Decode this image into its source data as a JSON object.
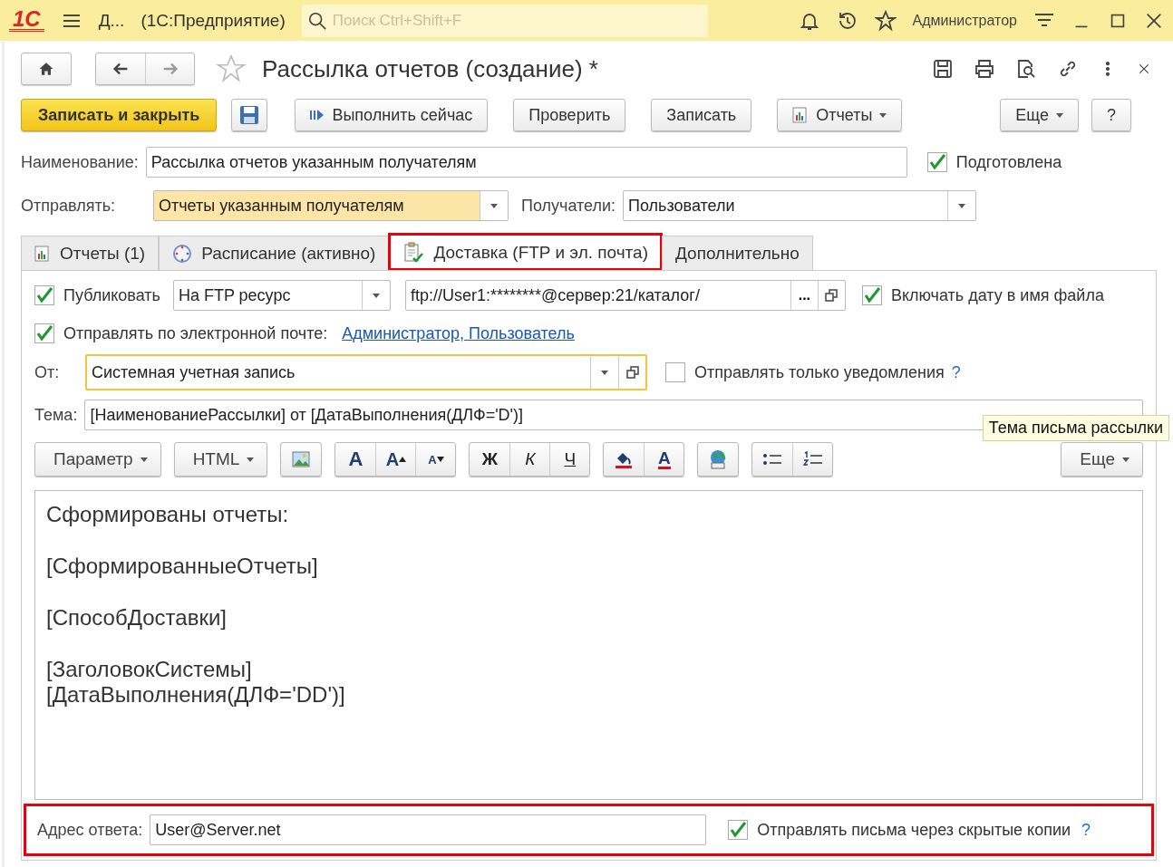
{
  "app_bar": {
    "logo": "1С",
    "section": "Д...",
    "app_name": "(1С:Предприятие)",
    "search": {
      "placeholder": "Поиск Ctrl+Shift+F"
    },
    "user": "Администратор"
  },
  "form": {
    "title": "Рассылка отчетов (создание) *",
    "favorite": false,
    "toolbar": [
      {
        "kind": "primary",
        "label": "Записать и закрыть"
      },
      {
        "kind": "save"
      },
      {
        "kind": "run",
        "label": "Выполнить сейчас"
      },
      {
        "kind": "plain",
        "label": "Проверить"
      },
      {
        "kind": "plain",
        "label": "Записать"
      },
      {
        "kind": "reports",
        "label": "Отчеты"
      },
      {
        "kind": "more",
        "label": "Еще"
      },
      {
        "kind": "plain",
        "label": "?"
      }
    ],
    "name": {
      "label": "Наименование:",
      "value": "Рассылка отчетов указанным получателям"
    },
    "prepared": {
      "label": "Подготовлена",
      "checked": true
    },
    "send": {
      "label": "Отправлять:",
      "value": "Отчеты указанным получателям"
    },
    "recipients": {
      "label": "Получатели:",
      "value": "Пользователи"
    },
    "tabs": [
      {
        "label": "Отчеты (1)",
        "selected": false,
        "highlighted": false
      },
      {
        "label": "Расписание (активно)",
        "selected": false,
        "highlighted": false
      },
      {
        "label": "Доставка (FTP и эл. почта)",
        "selected": true,
        "highlighted": true
      },
      {
        "label": "Дополнительно",
        "selected": false,
        "highlighted": false
      }
    ],
    "delivery": {
      "publish": {
        "label": "Публиковать",
        "checked": true,
        "method": "На FTP ресурс",
        "path": "ftp://User1:********@сервер:21/каталог/",
        "path_button": "...",
        "include_date": {
          "label": "Включать дату в имя файла",
          "checked": true
        }
      },
      "email": {
        "label": "Отправлять по электронной почте:",
        "checked": true,
        "recipients": "Администратор, Пользователь"
      },
      "from": {
        "label": "От:",
        "value": "Системная учетная запись",
        "notify_only": {
          "label": "Отправлять только уведомления",
          "checked": false
        },
        "help": "?"
      },
      "subject": {
        "label": "Тема:",
        "value": "[НаименованиеРассылки] от [ДатаВыполнения(ДЛФ='D')]",
        "tooltip": "Тема письма рассылки"
      },
      "editor_toolbar": [
        [
          {
            "kind": "dropdown",
            "label": "Параметр"
          }
        ],
        [
          {
            "kind": "dropdown",
            "label": "HTML"
          }
        ],
        [
          {
            "kind": "picture"
          }
        ],
        [
          {
            "kind": "font",
            "label": "A"
          },
          {
            "kind": "grow",
            "label": "A"
          },
          {
            "kind": "shrink",
            "label": "A"
          }
        ],
        [
          {
            "kind": "bold",
            "label": "Ж"
          },
          {
            "kind": "italic",
            "label": "К"
          },
          {
            "kind": "underline",
            "label": "Ч"
          }
        ],
        [
          {
            "kind": "fill"
          },
          {
            "kind": "color",
            "label": "A"
          }
        ],
        [
          {
            "kind": "globe"
          }
        ],
        [
          {
            "kind": "bullets"
          },
          {
            "kind": "numbers"
          }
        ],
        [
          {
            "kind": "dropdown",
            "label": "Еще"
          }
        ]
      ],
      "body": [
        [
          "Сформированы отчеты:"
        ],
        [
          "[СформированныеОтчеты]"
        ],
        [
          "[СпособДоставки]"
        ],
        [
          "[ЗаголовокСистемы]",
          "[ДатаВыполнения(ДЛФ='DD')]"
        ]
      ],
      "reply": {
        "label": "Адрес ответа:",
        "value": "User@Server.net",
        "highlighted": true,
        "bcc": {
          "label": "Отправлять письма через скрытые копии",
          "checked": true
        },
        "help": "?"
      }
    }
  }
}
